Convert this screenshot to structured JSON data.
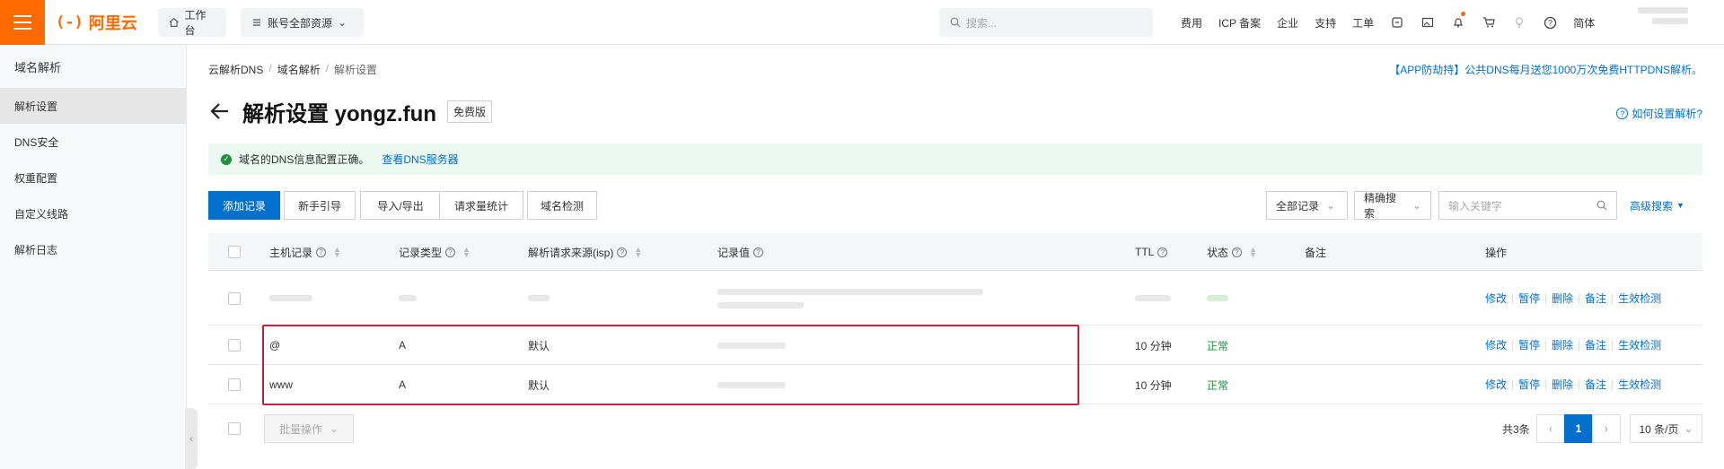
{
  "brand": {
    "logo_text": "阿里云",
    "logo_mark": "(-)",
    "accent": "#ff6a00"
  },
  "topbar": {
    "workbench": "工作台",
    "resources": "账号全部资源",
    "search_placeholder": "搜索...",
    "links": [
      "费用",
      "ICP 备案",
      "企业",
      "支持",
      "工单"
    ],
    "lang": "简体"
  },
  "sidebar": {
    "title": "域名解析",
    "items": [
      {
        "label": "解析设置",
        "active": true
      },
      {
        "label": "DNS安全"
      },
      {
        "label": "权重配置"
      },
      {
        "label": "自定义线路"
      },
      {
        "label": "解析日志"
      }
    ]
  },
  "breadcrumb": [
    "云解析DNS",
    "域名解析",
    "解析设置"
  ],
  "promo": "【APP防劫持】公共DNS每月送您1000万次免费HTTPDNS解析。",
  "page": {
    "title": "解析设置 yongz.fun",
    "badge": "免费版",
    "help": "如何设置解析?"
  },
  "notice": {
    "text": "域名的DNS信息配置正确。",
    "link": "查看DNS服务器"
  },
  "toolbar": {
    "add": "添加记录",
    "buttons": [
      "新手引导",
      "导入/导出",
      "请求量统计",
      "域名检测"
    ],
    "filter_all": "全部记录",
    "filter_mode": "精确搜索",
    "keyword_placeholder": "输入关键字",
    "advanced": "高级搜索"
  },
  "table": {
    "headers": {
      "host": "主机记录",
      "type": "记录类型",
      "isp": "解析请求来源(isp)",
      "value": "记录值",
      "ttl": "TTL",
      "status": "状态",
      "remark": "备注",
      "ops": "操作"
    },
    "rows": [
      {
        "host": "",
        "type": "",
        "isp": "",
        "value": "",
        "ttl": "",
        "status": "",
        "blurred": true
      },
      {
        "host": "@",
        "type": "A",
        "isp": "默认",
        "value": "",
        "ttl": "10 分钟",
        "status": "正常",
        "blurred": false
      },
      {
        "host": "www",
        "type": "A",
        "isp": "默认",
        "value": "",
        "ttl": "10 分钟",
        "status": "正常",
        "blurred": false
      }
    ],
    "ops": [
      "修改",
      "暂停",
      "删除",
      "备注",
      "生效检测"
    ]
  },
  "footer": {
    "bulk": "批量操作",
    "total": "共3条",
    "page": "1",
    "page_size": "10 条/页"
  }
}
